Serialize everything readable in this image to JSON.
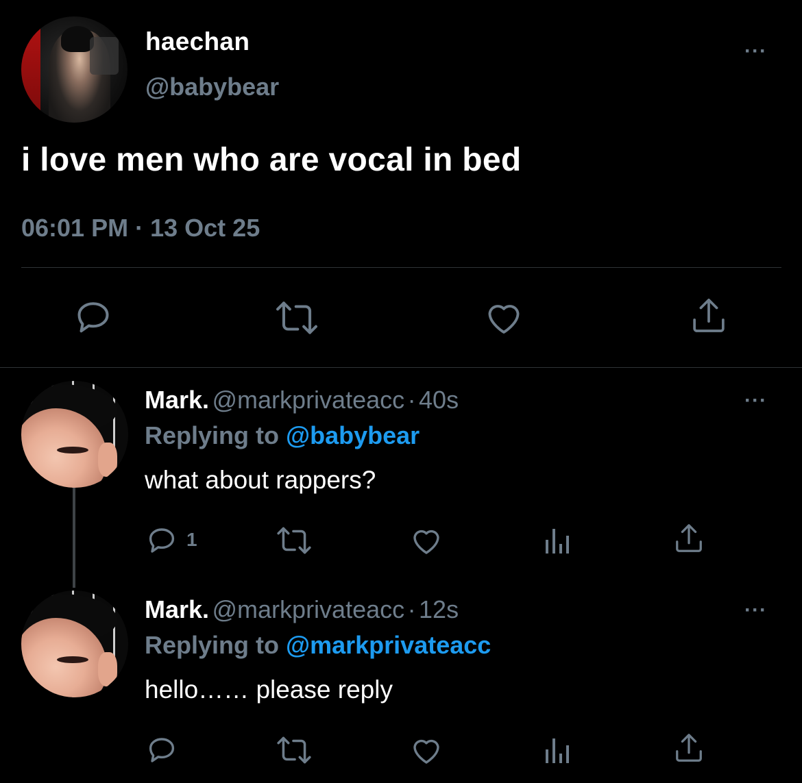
{
  "tweet": {
    "author_name": "haechan",
    "author_handle": "@babybear",
    "text": "i love men who are vocal in bed",
    "time": "06:01 PM",
    "separator": "·",
    "date": "13 Oct 25",
    "more": "···"
  },
  "replies": [
    {
      "author_name": "Mark.",
      "author_handle": "@markprivateacc",
      "separator": "·",
      "age": "40s",
      "replying_prefix": "Replying to",
      "replying_to": "@babybear",
      "text": "what about rappers?",
      "reply_count": "1",
      "more": "···"
    },
    {
      "author_name": "Mark.",
      "author_handle": "@markprivateacc",
      "separator": "·",
      "age": "12s",
      "replying_prefix": "Replying to",
      "replying_to": "@markprivateacc",
      "text": "hello…… please reply",
      "reply_count": "",
      "more": "···"
    }
  ],
  "icons": {
    "reply": "reply-icon",
    "retweet": "retweet-icon",
    "like": "like-icon",
    "share": "share-icon",
    "analytics": "analytics-icon"
  },
  "colors": {
    "background": "#000000",
    "text_primary": "#ffffff",
    "text_secondary": "#6e7d8b",
    "link": "#1d9bf0",
    "divider": "#2f3336"
  }
}
